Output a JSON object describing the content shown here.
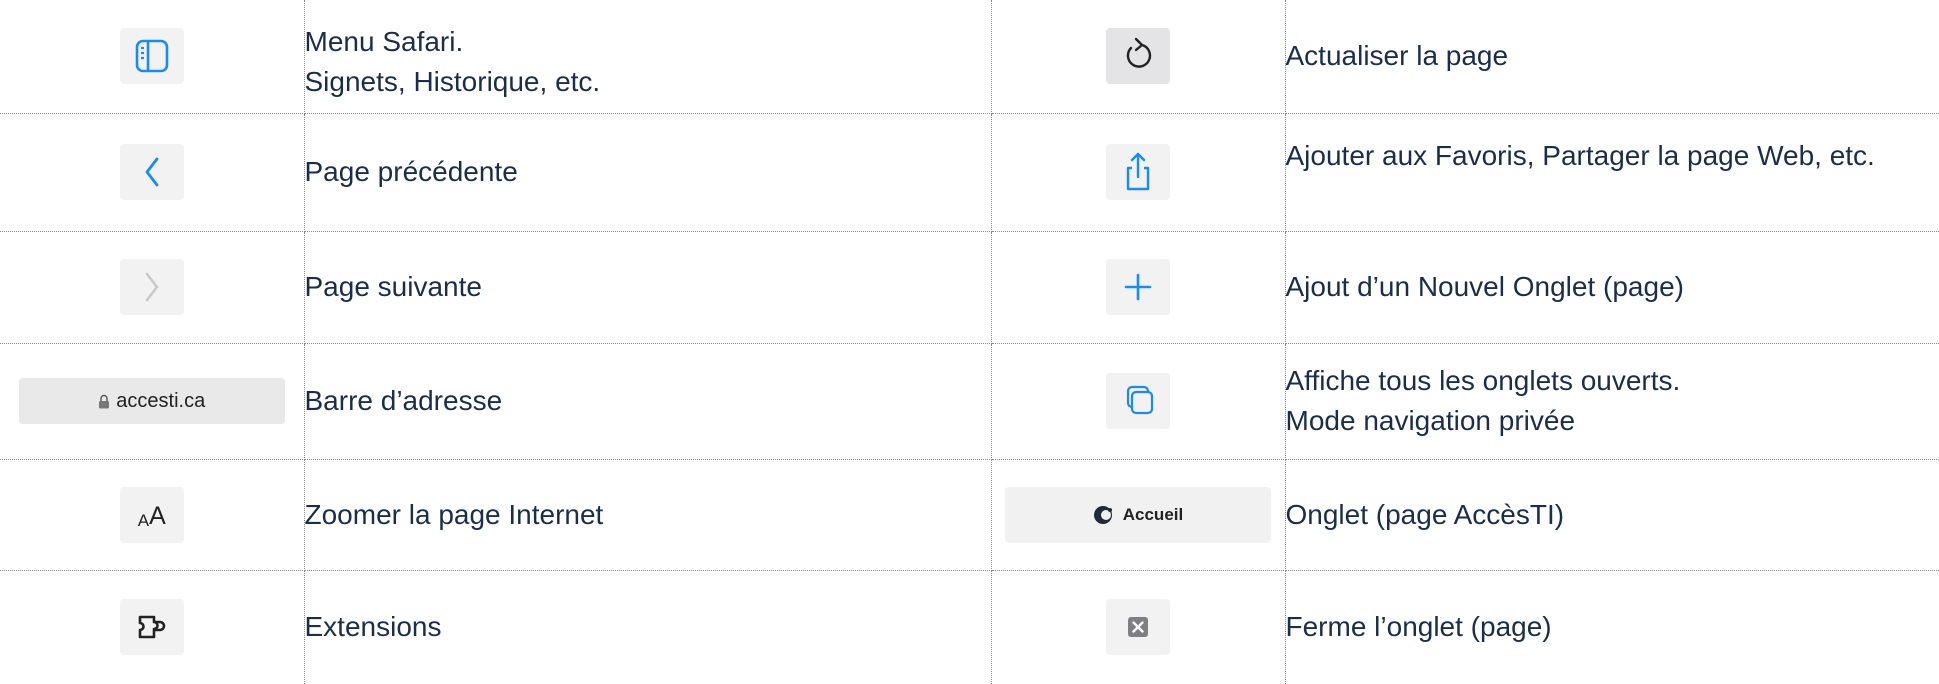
{
  "colors": {
    "text": "#1a2e4a",
    "accent_blue": "#1a8cf0",
    "icon_bg": "#f2f2f3",
    "border": "#8a8a8a"
  },
  "rows": [
    {
      "left": {
        "icon": "sidebar-icon",
        "lines": [
          "Menu Safari.",
          "Signets, Historique, etc."
        ]
      },
      "right": {
        "icon": "reload-icon",
        "lines": [
          "Actualiser la page"
        ]
      }
    },
    {
      "left": {
        "icon": "chevron-left-icon",
        "lines": [
          "Page précédente"
        ]
      },
      "right": {
        "icon": "share-icon",
        "lines": [
          "Ajouter aux Favoris, Partager la page Web, etc."
        ]
      }
    },
    {
      "left": {
        "icon": "chevron-right-icon",
        "lines": [
          "Page suivante"
        ]
      },
      "right": {
        "icon": "plus-icon",
        "lines": [
          "Ajout d’un Nouvel Onglet (page)"
        ]
      }
    },
    {
      "left": {
        "icon": "address-bar",
        "address_text": "accesti.ca",
        "lines": [
          "Barre d’adresse"
        ]
      },
      "right": {
        "icon": "tabs-overview-icon",
        "lines": [
          "Affiche tous les onglets ouverts.",
          "Mode navigation privée"
        ]
      }
    },
    {
      "left": {
        "icon": "text-size-icon",
        "icon_text_small": "A",
        "icon_text_big": "A",
        "lines": [
          "Zoomer la page Internet"
        ]
      },
      "right": {
        "icon": "tab-chip",
        "tab_text": "Accueil",
        "lines": [
          "Onglet (page AccèsTI)"
        ]
      }
    },
    {
      "left": {
        "icon": "extensions-icon",
        "lines": [
          "Extensions"
        ]
      },
      "right": {
        "icon": "close-tab-icon",
        "lines": [
          "Ferme l’onglet (page)"
        ]
      }
    }
  ]
}
